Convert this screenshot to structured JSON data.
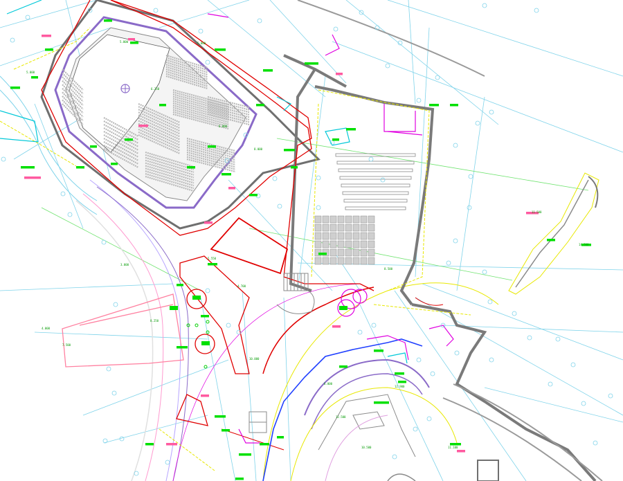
{
  "drawing": {
    "colors": {
      "background": "#ffffff",
      "grid": "#7fd3ea",
      "wall": "#6f6f6f",
      "boundary": "#e00000",
      "annotation": "#00d000",
      "outline_purple": "#8a6ac8",
      "magenta": "#e000e0",
      "route_blue": "#1f3fff",
      "yellow": "#e8e800",
      "cyan": "#00c8d8",
      "tag_bg": "#00e000",
      "tag_pink": "#ff5aa0"
    },
    "annotations": [
      {
        "text": "5.000",
        "kind": "level"
      },
      {
        "text": "5.000",
        "kind": "level"
      },
      {
        "text": "6.250",
        "kind": "level"
      },
      {
        "text": "6.000",
        "kind": "level"
      },
      {
        "text": "8.000",
        "kind": "level"
      },
      {
        "text": "5.000",
        "kind": "level"
      },
      {
        "text": "8.250",
        "kind": "level"
      },
      {
        "text": "7.500",
        "kind": "level"
      },
      {
        "text": "8.500",
        "kind": "level"
      },
      {
        "text": "5.550",
        "kind": "level"
      },
      {
        "text": "4.700",
        "kind": "level"
      },
      {
        "text": "10.000",
        "kind": "level"
      },
      {
        "text": "12.900",
        "kind": "level"
      },
      {
        "text": "6.000",
        "kind": "level"
      },
      {
        "text": "12.500",
        "kind": "level"
      },
      {
        "text": "10.500",
        "kind": "level"
      },
      {
        "text": "11.100",
        "kind": "level"
      },
      {
        "text": "11.500",
        "kind": "level"
      },
      {
        "text": "14.500",
        "kind": "level"
      },
      {
        "text": "4.000",
        "kind": "level"
      },
      {
        "text": "3.000",
        "kind": "level"
      }
    ]
  }
}
